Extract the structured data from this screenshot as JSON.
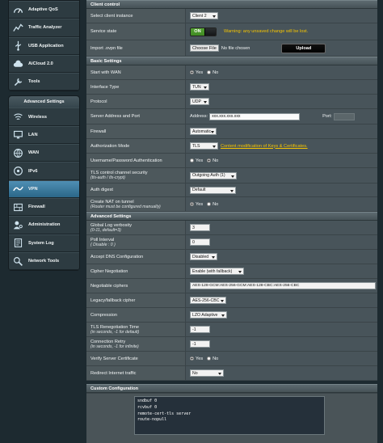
{
  "sidebar": {
    "top_items": [
      {
        "label": "Adaptive QoS",
        "icon": "adaptive-qos-icon"
      },
      {
        "label": "Traffic Analyzer",
        "icon": "traffic-analyzer-icon"
      },
      {
        "label": "USB Application",
        "icon": "usb-icon"
      },
      {
        "label": "AiCloud 2.0",
        "icon": "cloud-icon"
      },
      {
        "label": "Tools",
        "icon": "tools-icon"
      }
    ],
    "advanced_header": "Advanced Settings",
    "advanced_items": [
      {
        "label": "Wireless",
        "icon": "wireless-icon"
      },
      {
        "label": "LAN",
        "icon": "lan-icon"
      },
      {
        "label": "WAN",
        "icon": "wan-icon"
      },
      {
        "label": "IPv6",
        "icon": "ipv6-icon"
      },
      {
        "label": "VPN",
        "icon": "vpn-icon",
        "active": true
      },
      {
        "label": "Firewall",
        "icon": "firewall-icon"
      },
      {
        "label": "Administration",
        "icon": "administration-icon"
      },
      {
        "label": "System Log",
        "icon": "system-log-icon"
      },
      {
        "label": "Network Tools",
        "icon": "network-tools-icon"
      }
    ]
  },
  "client_control": {
    "header": "Client control",
    "instance_label": "Select client instance",
    "instance_value": "Client 2",
    "state_label": "Service state",
    "state_value": "ON",
    "warning": "Warning: any unsaved change will be lost.",
    "import_label": "Import .ovpn file",
    "choose_file": "Choose File",
    "no_file": "No file chosen",
    "upload": "Upload"
  },
  "basic": {
    "header": "Basic Settings",
    "start_wan_label": "Start with WAN",
    "yes": "Yes",
    "no": "No",
    "interface_label": "Interface Type",
    "interface_value": "TUN",
    "protocol_label": "Protocol",
    "protocol_value": "UDP",
    "server_label": "Server Address and Port",
    "address_label": "Address:",
    "address_value": "xxx.xxx.xxx.xxx",
    "port_label": "Port:",
    "port_value": "",
    "firewall_label": "Firewall",
    "firewall_value": "Automatic",
    "auth_mode_label": "Authorization Mode",
    "auth_mode_value": "TLS",
    "auth_mode_link": "Content modification of Keys & Certificates.",
    "userpass_label": "Username/Password Authentication",
    "tls_channel_label": "TLS control channel security",
    "tls_channel_note": "(tls-auth / tls-crypt)",
    "tls_channel_value": "Outgoing Auth (1)",
    "digest_label": "Auth digest",
    "digest_value": "Default",
    "nat_label": "Create NAT on tunnel",
    "nat_note": "(Router must be configured manually)"
  },
  "advanced": {
    "header": "Advanced Settings",
    "verbosity_label": "Global Log verbosity",
    "verbosity_note": "(0-11, default=3)",
    "verbosity_value": "3",
    "poll_label": "Poll Interval",
    "poll_note": "( Disable : 0 )",
    "poll_value": "0",
    "dns_label": "Accept DNS Configuration",
    "dns_value": "Disabled",
    "cipher_neg_label": "Cipher Negotiation",
    "cipher_neg_value": "Enable (with fallback)",
    "neg_ciphers_label": "Negotiable ciphers",
    "neg_ciphers_value": "AES-128-GCM:AES-256-GCM:AES-128-CBC:AES-256-CBC",
    "legacy_label": "Legacy/fallback cipher",
    "legacy_value": "AES-256-CBC",
    "compression_label": "Compression",
    "compression_value": "LZO Adaptive",
    "reneg_label": "TLS Renegotiation Time",
    "reneg_note": "(in seconds, -1 for default)",
    "reneg_value": "-1",
    "retry_label": "Connection Retry",
    "retry_note": "(in seconds, -1 for infinite)",
    "retry_value": "-1",
    "verify_label": "Verify Server Certificate",
    "redirect_label": "Redirect Internet traffic",
    "redirect_value": "No"
  },
  "custom": {
    "header": "Custom Configuration",
    "text": "sndbuf 0\nrcvbuf 0\nremote-cert-tls server\nroute-nopull"
  },
  "colors": {
    "accent_green": "#4f9a2d",
    "warning_yellow": "#f5c400",
    "active_blue": "#3e7ca0"
  }
}
